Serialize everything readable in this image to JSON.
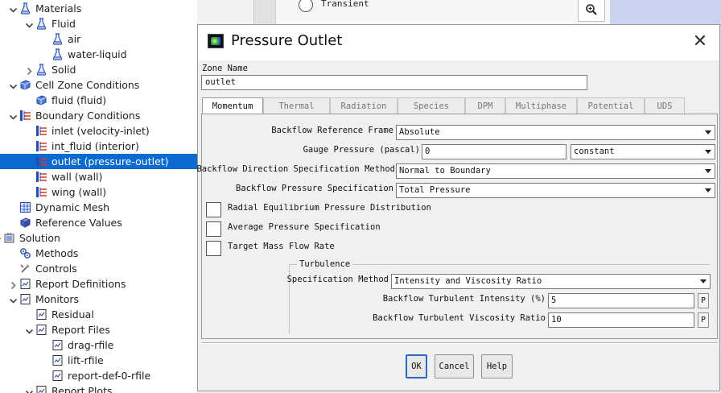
{
  "tree": {
    "items": [
      {
        "label": "Materials",
        "arrow": "expanded",
        "icon": "flask-icon"
      },
      {
        "label": "Fluid",
        "arrow": "expanded",
        "icon": "flask-icon"
      },
      {
        "label": "air",
        "arrow": "",
        "icon": "flask-icon"
      },
      {
        "label": "water-liquid",
        "arrow": "",
        "icon": "flask-icon"
      },
      {
        "label": "Solid",
        "arrow": "collapsed",
        "icon": "flask-icon"
      },
      {
        "label": "Cell Zone Conditions",
        "arrow": "expanded",
        "icon": "cube-icon"
      },
      {
        "label": "fluid (fluid)",
        "arrow": "",
        "icon": "cube-icon"
      },
      {
        "label": "Boundary Conditions",
        "arrow": "expanded",
        "icon": "boundary-icon"
      },
      {
        "label": "inlet (velocity-inlet)",
        "arrow": "",
        "icon": "boundary-icon"
      },
      {
        "label": "int_fluid (interior)",
        "arrow": "",
        "icon": "boundary-icon"
      },
      {
        "label": "outlet (pressure-outlet)",
        "arrow": "",
        "icon": "boundary-icon"
      },
      {
        "label": "wall (wall)",
        "arrow": "",
        "icon": "boundary-icon"
      },
      {
        "label": "wing (wall)",
        "arrow": "",
        "icon": "boundary-icon"
      },
      {
        "label": "Dynamic Mesh",
        "arrow": "",
        "icon": "mesh-icon"
      },
      {
        "label": "Reference Values",
        "arrow": "",
        "icon": "reference-icon"
      },
      {
        "label": "Solution",
        "arrow": "expanded",
        "icon": "solution-icon"
      },
      {
        "label": "Methods",
        "arrow": "",
        "icon": "methods-icon"
      },
      {
        "label": "Controls",
        "arrow": "",
        "icon": "controls-icon"
      },
      {
        "label": "Report Definitions",
        "arrow": "collapsed",
        "icon": "report-icon"
      },
      {
        "label": "Monitors",
        "arrow": "expanded",
        "icon": "report-icon"
      },
      {
        "label": "Residual",
        "arrow": "",
        "icon": "report-icon"
      },
      {
        "label": "Report Files",
        "arrow": "expanded",
        "icon": "report-icon"
      },
      {
        "label": "drag-rfile",
        "arrow": "",
        "icon": "report-icon"
      },
      {
        "label": "lift-rfile",
        "arrow": "",
        "icon": "report-icon"
      },
      {
        "label": "report-def-0-rfile",
        "arrow": "",
        "icon": "report-icon"
      },
      {
        "label": "Report Plots",
        "arrow": "expanded",
        "icon": "report-icon"
      }
    ],
    "selected_label": "outlet (pressure-outlet)"
  },
  "background": {
    "radio_label": "Transient",
    "zoom_icon": "zoom-in-icon"
  },
  "dialog": {
    "title": "Pressure Outlet",
    "close_glyph": "✕",
    "zone_name_label": "Zone Name",
    "zone_name_value": "outlet",
    "tabs": [
      "Momentum",
      "Thermal",
      "Radiation",
      "Species",
      "DPM",
      "Multiphase",
      "Potential",
      "UDS"
    ],
    "active_tab": "Momentum",
    "momentum": {
      "backflow_ref_frame_label": "Backflow Reference Frame",
      "backflow_ref_frame_value": "Absolute",
      "gauge_pressure_label": "Gauge Pressure (pascal)",
      "gauge_pressure_value": "0",
      "gauge_pressure_profile": "constant",
      "backflow_dir_label": "Backflow Direction Specification Method",
      "backflow_dir_value": "Normal to Boundary",
      "backflow_pressure_label": "Backflow Pressure Specification",
      "backflow_pressure_value": "Total Pressure",
      "radial_eq_label": "Radial Equilibrium Pressure Distribution",
      "avg_pressure_label": "Average Pressure Specification",
      "target_mass_label": "Target Mass Flow Rate",
      "turbulence": {
        "group_label": "Turbulence",
        "spec_method_label": "Specification Method",
        "spec_method_value": "Intensity and Viscosity Ratio",
        "intensity_label": "Backflow Turbulent Intensity (%)",
        "intensity_value": "5",
        "viscosity_label": "Backflow Turbulent Viscosity Ratio",
        "viscosity_value": "10",
        "param_button": "P"
      }
    },
    "buttons": {
      "ok": "OK",
      "cancel": "Cancel",
      "help": "Help"
    }
  }
}
